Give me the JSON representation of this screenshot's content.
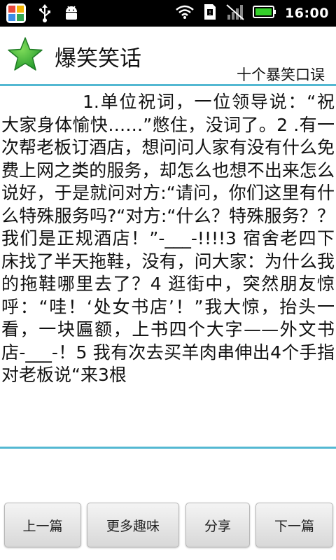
{
  "status_bar": {
    "time": "16:00",
    "icons": [
      "app-icon",
      "usb-icon",
      "android-debug-icon",
      "wifi-icon",
      "sd-card-icon",
      "signal-icon",
      "battery-icon"
    ]
  },
  "header": {
    "title": "爆笑笑话",
    "subtitle": "十个暴笑口误",
    "logo_icon": "star-icon"
  },
  "content": {
    "text": "1.单位祝词，一位领导说：“祝大家身体愉快……”憋住，没词了。2 .有一次帮老板订酒店，想问问人家有没有什么免费上网之类的服务，却怎么也想不出来怎么说好，于是就问对方:“请问，你们这里有什么特殊服务吗?“对方:“什么？特殊服务？？我们是正规酒店！”-___-!!!!3 宿舍老四下床找了半天拖鞋，没有，问大家：为什么我的拖鞋哪里去了？4 逛街中，突然朋友惊呼：“哇！‘处女书店’！”我大惊，抬头一看，一块匾额，上书四个大字——外文书店-___-！5 我有次去买羊肉串伸出4个手指对老板说“来3根"
  },
  "buttons": {
    "prev": "上一篇",
    "more": "更多趣味",
    "share": "分享",
    "next": "下一篇"
  },
  "colors": {
    "accent": "#53b8d2",
    "status_bar": "#000000",
    "star": "#3aa63a",
    "battery": "#35d02a"
  }
}
